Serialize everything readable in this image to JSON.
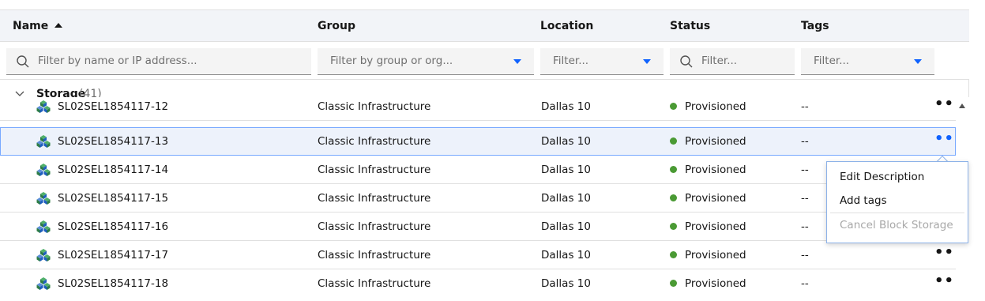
{
  "columns": {
    "name": "Name",
    "group": "Group",
    "location": "Location",
    "status": "Status",
    "tags": "Tags"
  },
  "filters": {
    "name_placeholder": "Filter by name or IP address...",
    "group_placeholder": "Filter by group or org...",
    "location_placeholder": "Filter...",
    "status_placeholder": "Filter...",
    "tags_placeholder": "Filter..."
  },
  "group": {
    "label": "Storage",
    "count": "(41)"
  },
  "rows": [
    {
      "name": "SL02SEL1854117-12",
      "group": "Classic Infrastructure",
      "location": "Dallas 10",
      "status": "Provisioned",
      "tags": "--"
    },
    {
      "name": "SL02SEL1854117-13",
      "group": "Classic Infrastructure",
      "location": "Dallas 10",
      "status": "Provisioned",
      "tags": "--"
    },
    {
      "name": "SL02SEL1854117-14",
      "group": "Classic Infrastructure",
      "location": "Dallas 10",
      "status": "Provisioned",
      "tags": "--"
    },
    {
      "name": "SL02SEL1854117-15",
      "group": "Classic Infrastructure",
      "location": "Dallas 10",
      "status": "Provisioned",
      "tags": "--"
    },
    {
      "name": "SL02SEL1854117-16",
      "group": "Classic Infrastructure",
      "location": "Dallas 10",
      "status": "Provisioned",
      "tags": "--"
    },
    {
      "name": "SL02SEL1854117-17",
      "group": "Classic Infrastructure",
      "location": "Dallas 10",
      "status": "Provisioned",
      "tags": "--"
    },
    {
      "name": "SL02SEL1854117-18",
      "group": "Classic Infrastructure",
      "location": "Dallas 10",
      "status": "Provisioned",
      "tags": "--"
    }
  ],
  "overflow_label": "•••",
  "context_menu": {
    "edit_description": "Edit Description",
    "add_tags": "Add tags",
    "cancel_block_storage": "Cancel Block Storage"
  },
  "colors": {
    "status_provisioned": "#4a9a34",
    "accent": "#0f62fe",
    "selected_row": "#edf2fb"
  },
  "icons": {
    "storage": "block-storage-icon",
    "search": "search-icon",
    "sort": "sort-ascending-icon",
    "expand": "chevron-down-icon"
  }
}
